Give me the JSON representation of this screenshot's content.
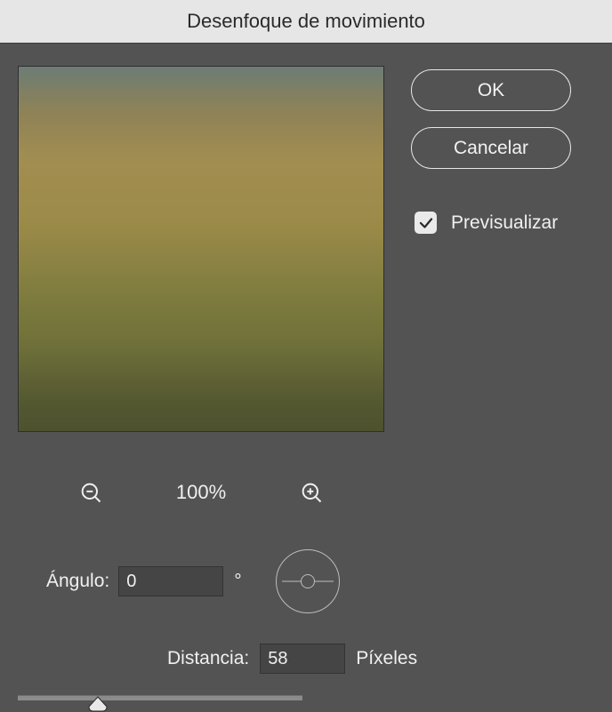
{
  "dialog": {
    "title": "Desenfoque de movimiento"
  },
  "buttons": {
    "ok": "OK",
    "cancel": "Cancelar"
  },
  "preview_checkbox": {
    "label": "Previsualizar",
    "checked": true
  },
  "zoom": {
    "level": "100%"
  },
  "angle": {
    "label": "Ángulo:",
    "value": "0",
    "unit": "°"
  },
  "distance": {
    "label": "Distancia:",
    "value": "58",
    "unit": "Píxeles"
  },
  "slider": {
    "percent": 28
  },
  "icons": {
    "zoom_out": "zoom-out-icon",
    "zoom_in": "zoom-in-icon",
    "check": "check-icon",
    "angle_dial": "angle-dial-icon",
    "slider_thumb": "slider-thumb-icon"
  }
}
